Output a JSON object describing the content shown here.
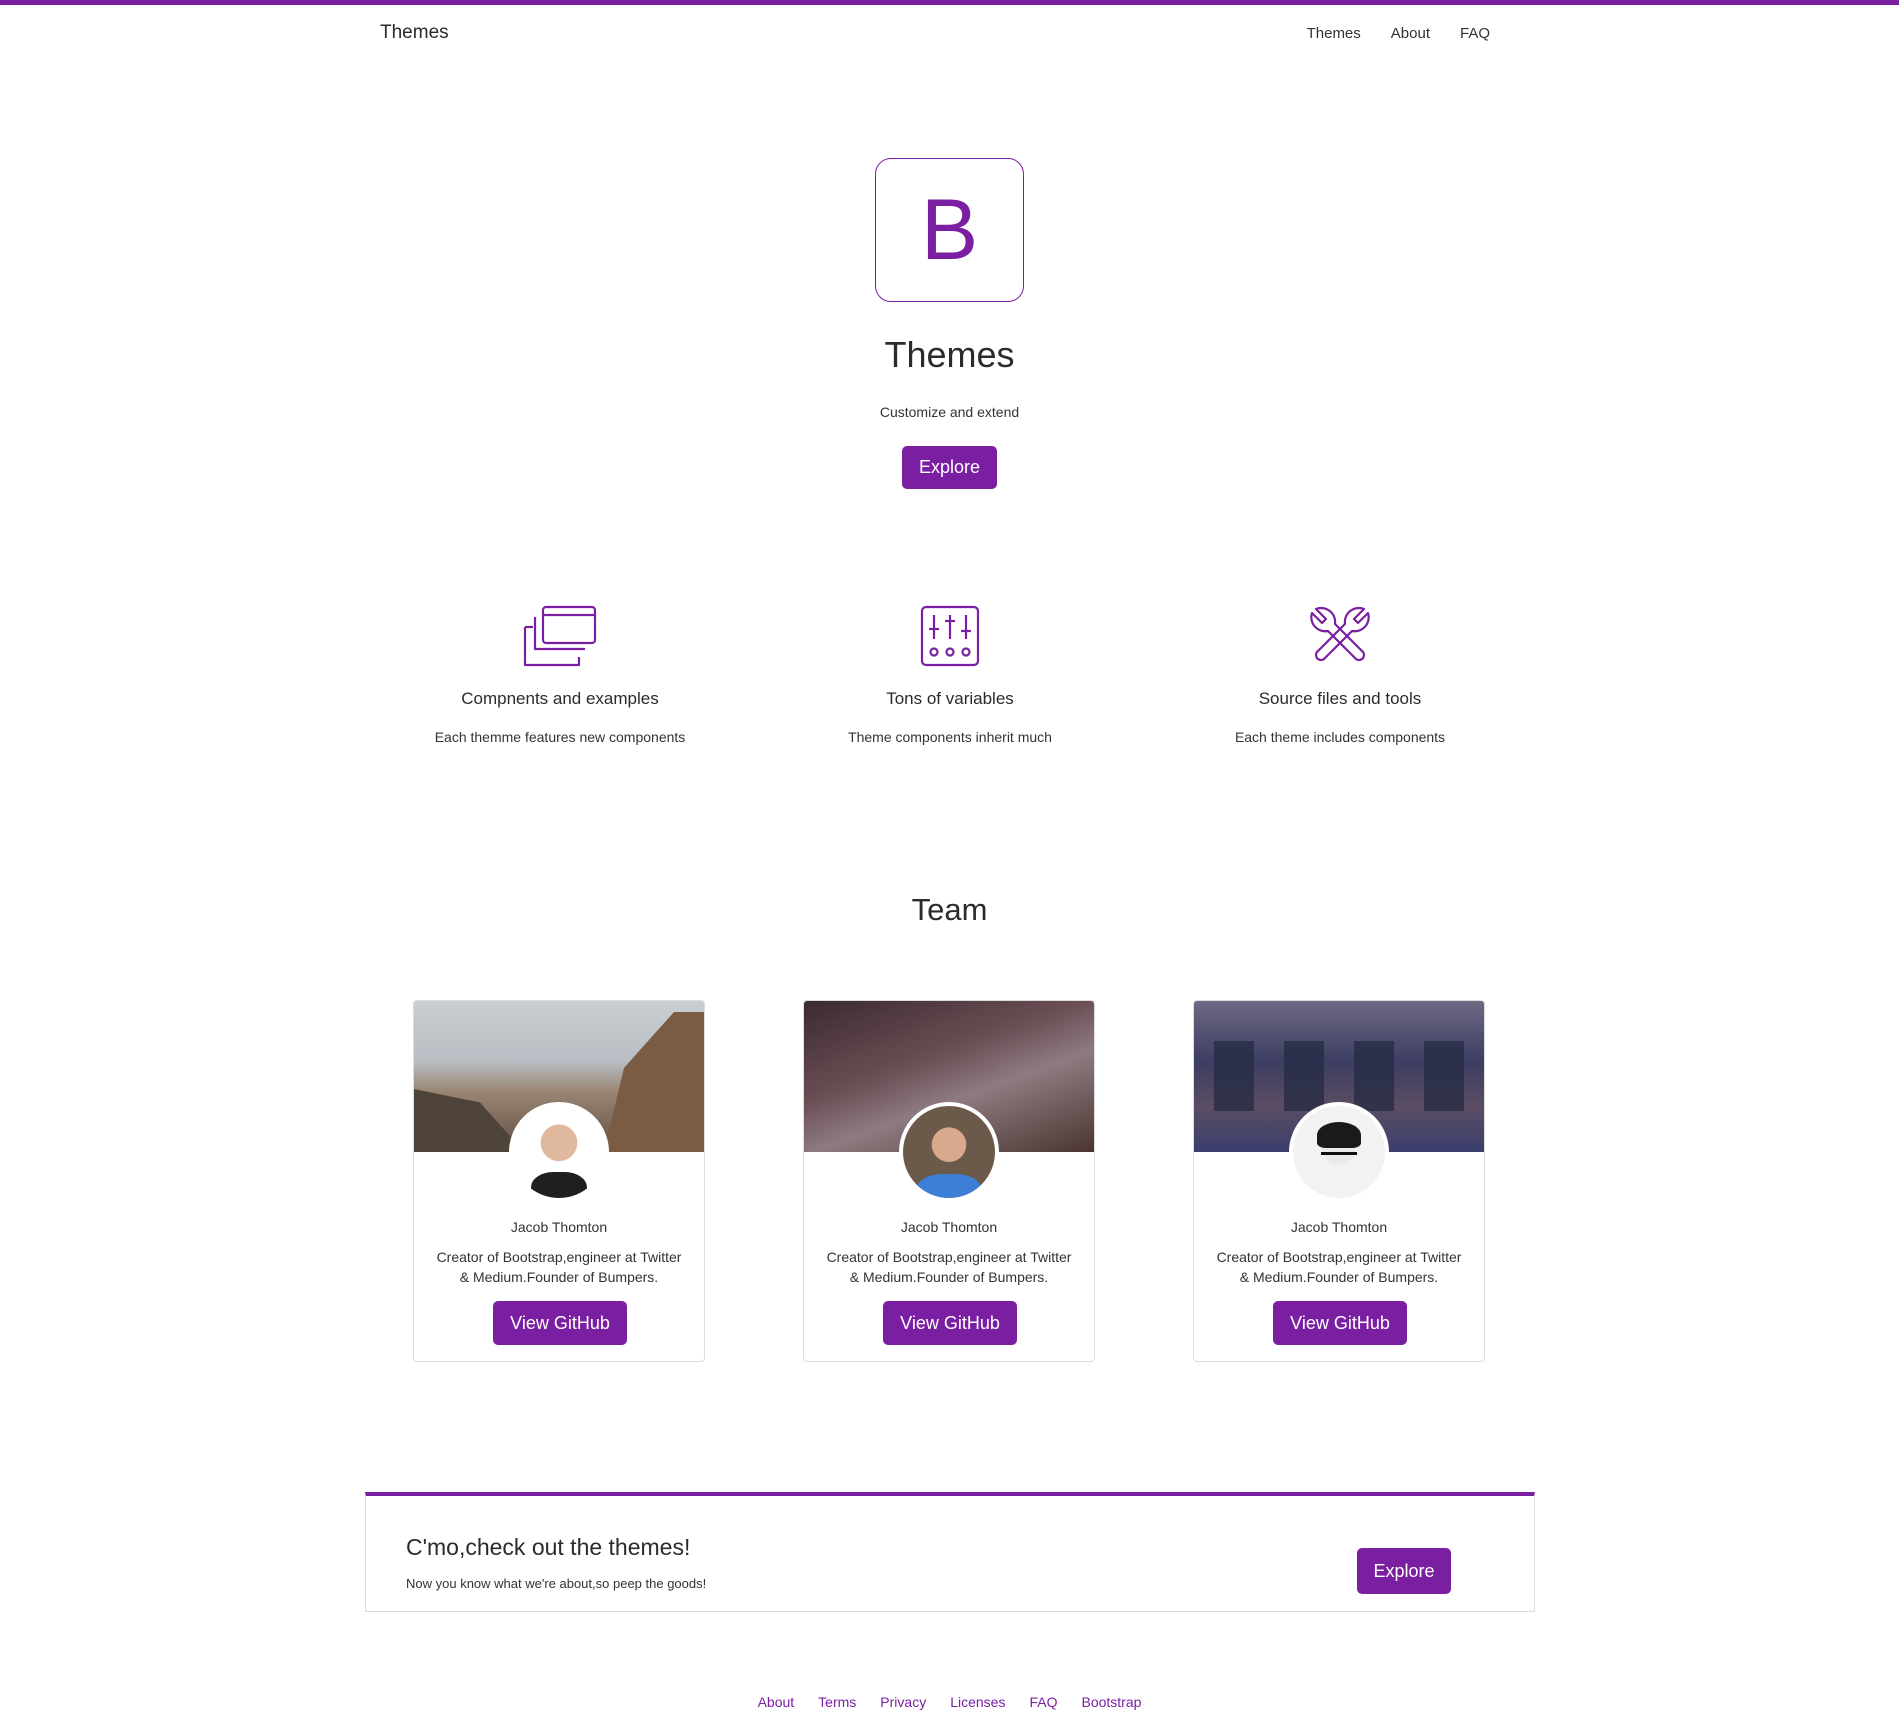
{
  "colors": {
    "accent": "#7b1fa2",
    "text": "#2b2b2b"
  },
  "nav": {
    "brand": "Themes",
    "links": [
      "Themes",
      "About",
      "FAQ"
    ]
  },
  "hero": {
    "logo_letter": "B",
    "title": "Themes",
    "subtitle": "Customize and extend",
    "button": "Explore"
  },
  "features": [
    {
      "icon": "windows-stack-icon",
      "title": "Compnents and examples",
      "text": "Each themme features new components"
    },
    {
      "icon": "sliders-icon",
      "title": "Tons of variables",
      "text": "Theme components inherit much"
    },
    {
      "icon": "wrench-tools-icon",
      "title": "Source files and tools",
      "text": "Each theme includes components"
    }
  ],
  "team": {
    "title": "Team",
    "members": [
      {
        "name": "Jacob Thomton",
        "bio": "Creator of Bootstrap,engineer at Twitter & Medium.Founder of Bumpers.",
        "button": "View GitHub"
      },
      {
        "name": "Jacob Thomton",
        "bio": "Creator of Bootstrap,engineer at Twitter & Medium.Founder of Bumpers.",
        "button": "View GitHub"
      },
      {
        "name": "Jacob Thomton",
        "bio": "Creator of Bootstrap,engineer at Twitter & Medium.Founder of Bumpers.",
        "button": "View GitHub"
      }
    ]
  },
  "cta": {
    "title": "C'mo,check out the themes!",
    "subtitle": "Now you know what we're about,so peep the goods!",
    "button": "Explore"
  },
  "footer": {
    "links": [
      "About",
      "Terms",
      "Privacy",
      "Licenses",
      "FAQ",
      "Bootstrap"
    ]
  }
}
